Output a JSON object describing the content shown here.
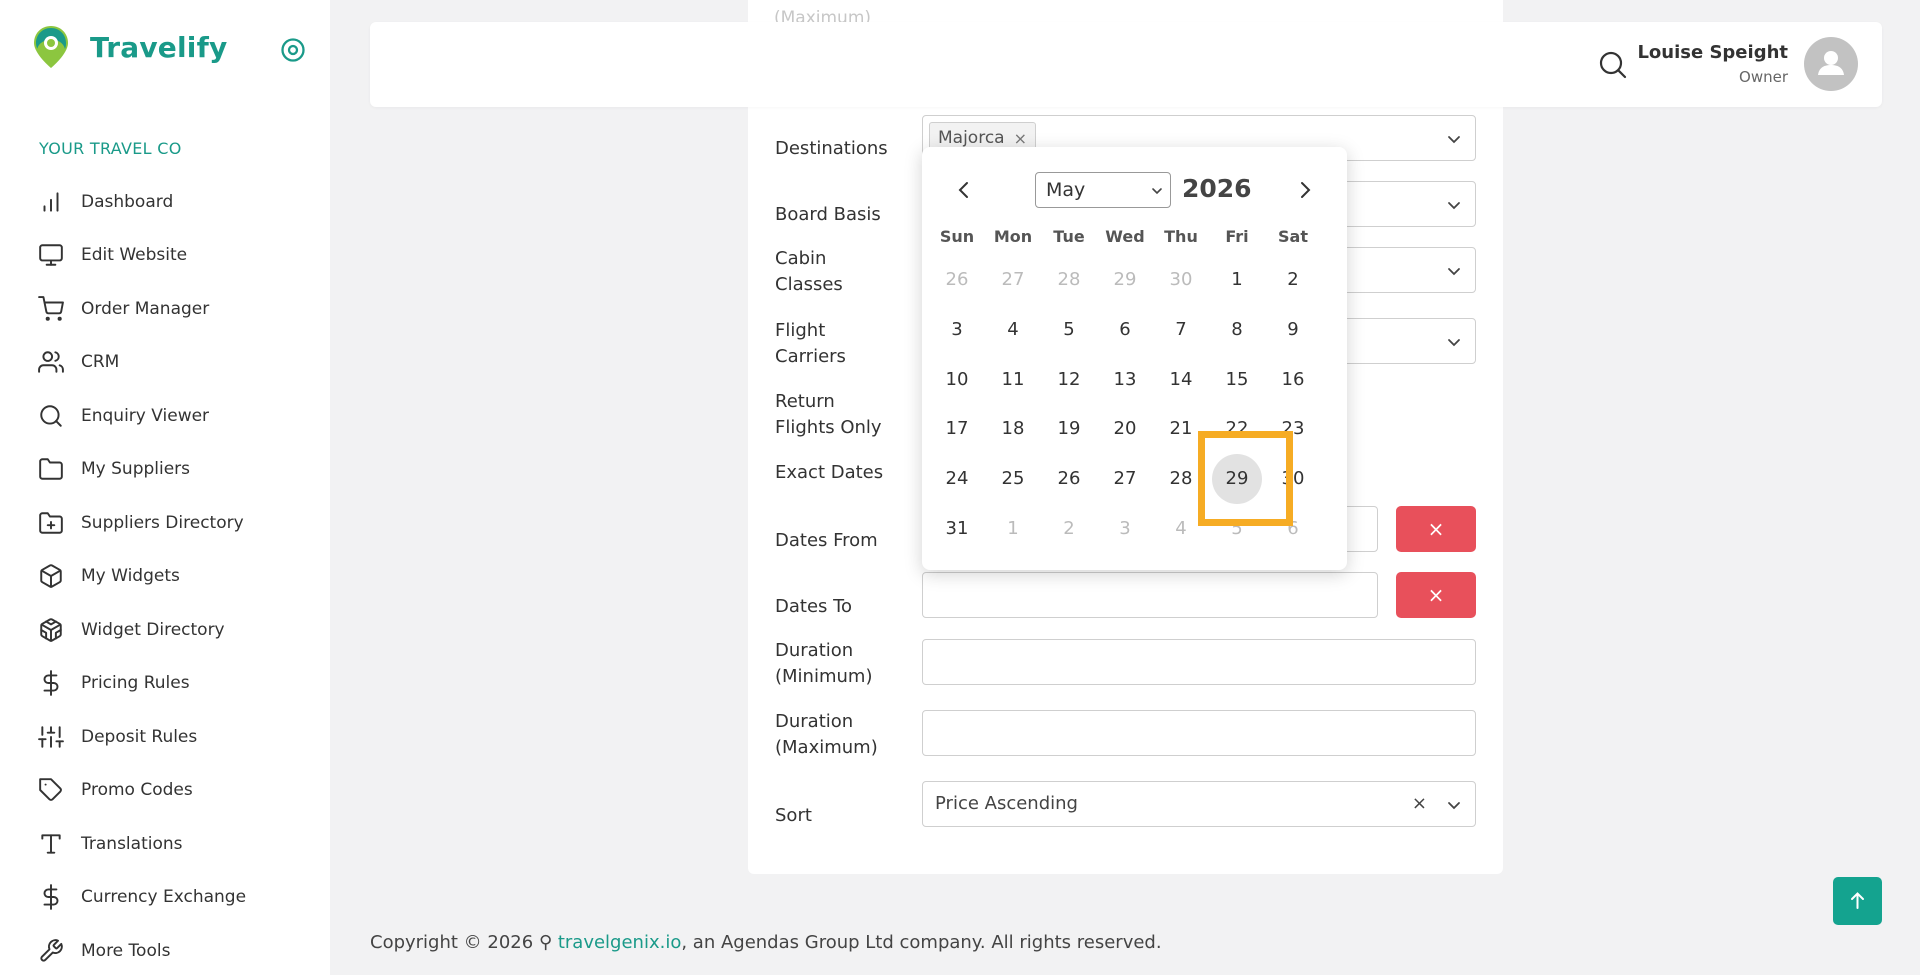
{
  "brand": {
    "name": "Travelify"
  },
  "sidebar": {
    "section_label": "YOUR TRAVEL CO",
    "items": [
      {
        "label": "Dashboard",
        "icon": "bar-chart-icon"
      },
      {
        "label": "Edit Website",
        "icon": "monitor-icon"
      },
      {
        "label": "Order Manager",
        "icon": "cart-icon"
      },
      {
        "label": "CRM",
        "icon": "users-icon"
      },
      {
        "label": "Enquiry Viewer",
        "icon": "search-icon"
      },
      {
        "label": "My Suppliers",
        "icon": "folder-icon"
      },
      {
        "label": "Suppliers Directory",
        "icon": "folder-plus-icon"
      },
      {
        "label": "My Widgets",
        "icon": "box-icon"
      },
      {
        "label": "Widget Directory",
        "icon": "codesandbox-icon"
      },
      {
        "label": "Pricing Rules",
        "icon": "dollar-icon"
      },
      {
        "label": "Deposit Rules",
        "icon": "sliders-icon"
      },
      {
        "label": "Promo Codes",
        "icon": "tag-icon"
      },
      {
        "label": "Translations",
        "icon": "type-icon"
      },
      {
        "label": "Currency Exchange",
        "icon": "dollar-icon"
      },
      {
        "label": "More Tools",
        "icon": "wrench-icon"
      }
    ]
  },
  "header": {
    "user_name": "Louise Speight",
    "user_role": "Owner"
  },
  "form": {
    "ghost_label": "(Maximum)",
    "destinations_label": "Destinations",
    "destination_tag": "Majorca",
    "board_basis_label": "Board Basis",
    "cabin_classes_label_1": "Cabin",
    "cabin_classes_label_2": "Classes",
    "flight_carriers_label_1": "Flight",
    "flight_carriers_label_2": "Carriers",
    "return_flights_label_1": "Return",
    "return_flights_label_2": "Flights Only",
    "exact_dates_label": "Exact Dates",
    "dates_from_label": "Dates From",
    "dates_to_label": "Dates To",
    "duration_min_label_1": "Duration",
    "duration_min_label_2": "(Minimum)",
    "duration_max_label_1": "Duration",
    "duration_max_label_2": "(Maximum)",
    "sort_label": "Sort",
    "sort_value": "Price Ascending",
    "clear_symbol": "×",
    "tag_remove_symbol": "×"
  },
  "datepicker": {
    "month": "May",
    "year": "2026",
    "weekdays": [
      "Sun",
      "Mon",
      "Tue",
      "Wed",
      "Thu",
      "Fri",
      "Sat"
    ],
    "weeks": [
      [
        "26",
        "27",
        "28",
        "29",
        "30",
        "1",
        "2"
      ],
      [
        "3",
        "4",
        "5",
        "6",
        "7",
        "8",
        "9"
      ],
      [
        "10",
        "11",
        "12",
        "13",
        "14",
        "15",
        "16"
      ],
      [
        "17",
        "18",
        "19",
        "20",
        "21",
        "22",
        "23"
      ],
      [
        "24",
        "25",
        "26",
        "27",
        "28",
        "29",
        "30"
      ],
      [
        "31",
        "1",
        "2",
        "3",
        "4",
        "5",
        "6"
      ]
    ],
    "selected_day": "29"
  },
  "footer": {
    "prefix": "Copyright © 2026 ",
    "link": "travelgenix.io",
    "suffix": ", an Agendas Group Ltd company. All rights reserved."
  },
  "colors": {
    "brand": "#1a9a89",
    "danger": "#e8505b",
    "highlight": "#f6ac24"
  }
}
